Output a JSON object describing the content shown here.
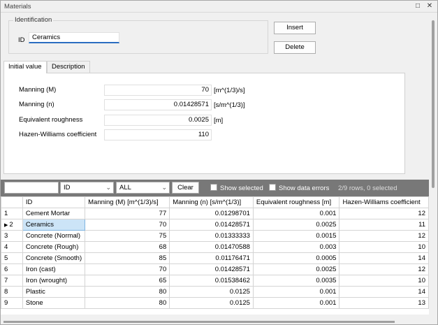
{
  "window": {
    "title": "Materials"
  },
  "identification": {
    "legend": "Identification",
    "id_label": "ID",
    "id_value": "Ceramics"
  },
  "buttons": {
    "insert": "Insert",
    "delete": "Delete"
  },
  "tabs": [
    {
      "label": "Initial value",
      "active": true
    },
    {
      "label": "Description",
      "active": false
    }
  ],
  "properties": [
    {
      "label": "Manning (M)",
      "value": "70",
      "unit": "[m^(1/3)/s]"
    },
    {
      "label": "Manning (n)",
      "value": "0.01428571",
      "unit": "[s/m^(1/3)]"
    },
    {
      "label": "Equivalent roughness",
      "value": "0.0025",
      "unit": "[m]"
    },
    {
      "label": "Hazen-Williams coefficient",
      "value": "110",
      "unit": ""
    }
  ],
  "filter": {
    "search_value": "",
    "field": "ID",
    "scope": "ALL",
    "clear": "Clear",
    "show_selected": "Show selected",
    "show_errors": "Show data errors",
    "rowcount": "2/9 rows, 0 selected"
  },
  "grid": {
    "columns": [
      "",
      "ID",
      "Manning (M) [m^(1/3)/s]",
      "Manning (n) [s/m^(1/3)]",
      "Equivalent roughness [m]",
      "Hazen-Williams coefficient"
    ],
    "rows": [
      {
        "n": "1",
        "id": "Cement Mortar",
        "m": "77",
        "nv": "0.01298701",
        "er": "0.001",
        "hw": "12"
      },
      {
        "n": "2",
        "id": "Ceramics",
        "m": "70",
        "nv": "0.01428571",
        "er": "0.0025",
        "hw": "11",
        "current": true
      },
      {
        "n": "3",
        "id": "Concrete (Normal)",
        "m": "75",
        "nv": "0.01333333",
        "er": "0.0015",
        "hw": "12"
      },
      {
        "n": "4",
        "id": "Concrete (Rough)",
        "m": "68",
        "nv": "0.01470588",
        "er": "0.003",
        "hw": "10"
      },
      {
        "n": "5",
        "id": "Concrete (Smooth)",
        "m": "85",
        "nv": "0.01176471",
        "er": "0.0005",
        "hw": "14"
      },
      {
        "n": "6",
        "id": "Iron (cast)",
        "m": "70",
        "nv": "0.01428571",
        "er": "0.0025",
        "hw": "12"
      },
      {
        "n": "7",
        "id": "Iron (wrought)",
        "m": "65",
        "nv": "0.01538462",
        "er": "0.0035",
        "hw": "10"
      },
      {
        "n": "8",
        "id": "Plastic",
        "m": "80",
        "nv": "0.0125",
        "er": "0.001",
        "hw": "14"
      },
      {
        "n": "9",
        "id": "Stone",
        "m": "80",
        "nv": "0.0125",
        "er": "0.001",
        "hw": "13"
      }
    ]
  }
}
